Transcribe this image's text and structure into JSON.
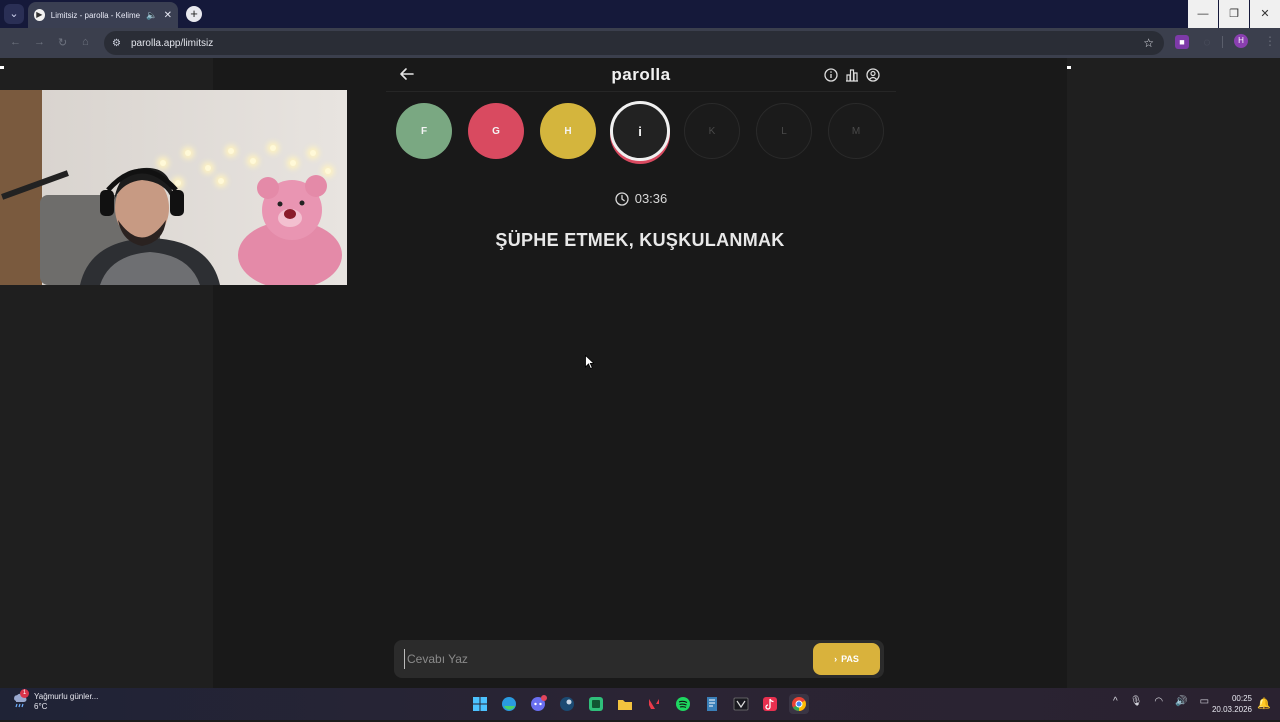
{
  "browser": {
    "tab_title": "Limitsiz - parolla - Kelime o",
    "url": "parolla.app/limitsiz",
    "profile_initial": "H"
  },
  "app": {
    "logo": "parolla",
    "letters": [
      {
        "char": "F",
        "state": "correct"
      },
      {
        "char": "G",
        "state": "wrong"
      },
      {
        "char": "H",
        "state": "passed"
      },
      {
        "char": "i",
        "state": "current"
      },
      {
        "char": "K",
        "state": "pending"
      },
      {
        "char": "L",
        "state": "pending"
      },
      {
        "char": "M",
        "state": "pending"
      }
    ],
    "timer": "03:36",
    "question": "ŞÜPHE ETMEK, KUŞKULANMAK",
    "answer": {
      "placeholder": "Cevabı Yaz",
      "value": "",
      "pas_label": "PAS"
    },
    "colors": {
      "correct": "#7aa882",
      "wrong": "#d94a60",
      "passed": "#d4b53d",
      "pas_button": "#d9b23c"
    }
  },
  "taskbar": {
    "weather_text": "Yağmurlu günler...",
    "temperature": "6°C",
    "weather_badge": "1",
    "time": "00:25",
    "date": "20.03.2026",
    "apps": [
      "windows-start",
      "edge",
      "discord",
      "steam",
      "app-green",
      "file-explorer",
      "valorant",
      "spotify",
      "app-tool",
      "app-dark",
      "tiktok",
      "chrome"
    ]
  }
}
